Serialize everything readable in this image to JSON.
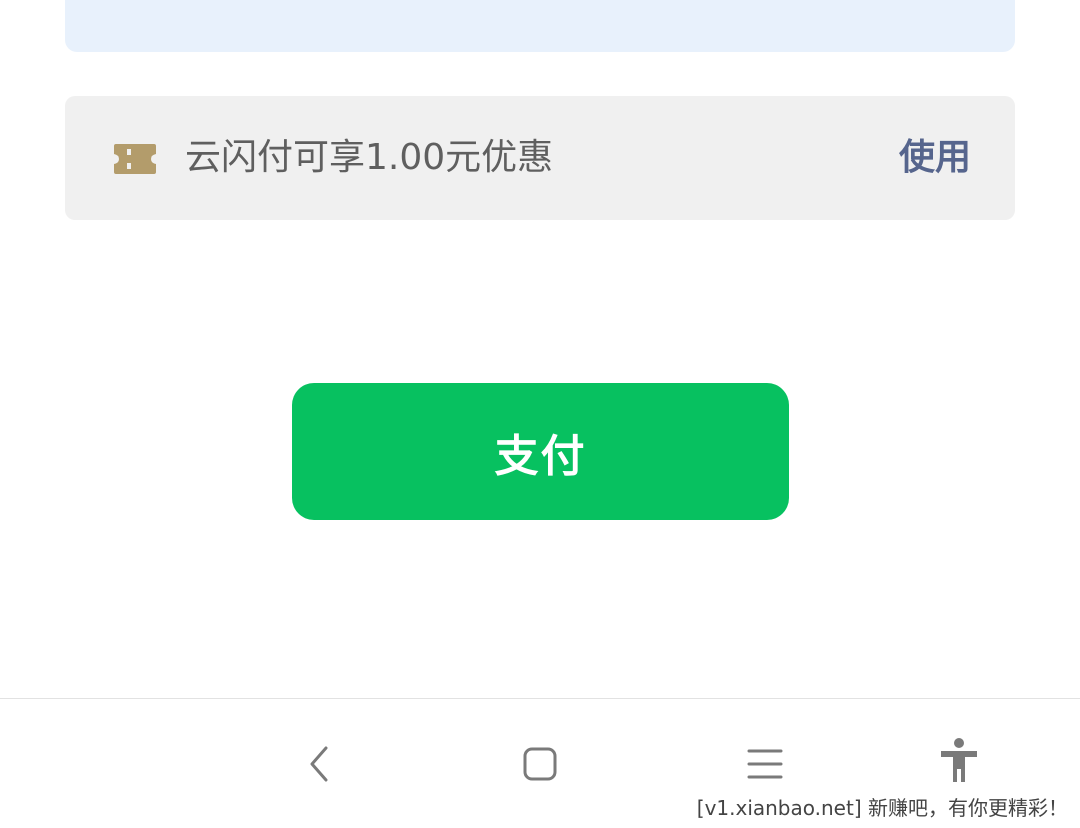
{
  "coupon": {
    "text": "云闪付可享1.00元优惠",
    "action_label": "使用",
    "icon": "ticket-icon",
    "icon_color": "#b39c6b",
    "action_color": "#56658d"
  },
  "pay": {
    "label": "支付",
    "color": "#07c160"
  },
  "navigation": {
    "icons": [
      "back-icon",
      "home-icon",
      "recent-apps-icon",
      "accessibility-icon"
    ]
  },
  "watermark": {
    "text": "[v1.xianbao.net] 新赚吧，有你更精彩！"
  }
}
